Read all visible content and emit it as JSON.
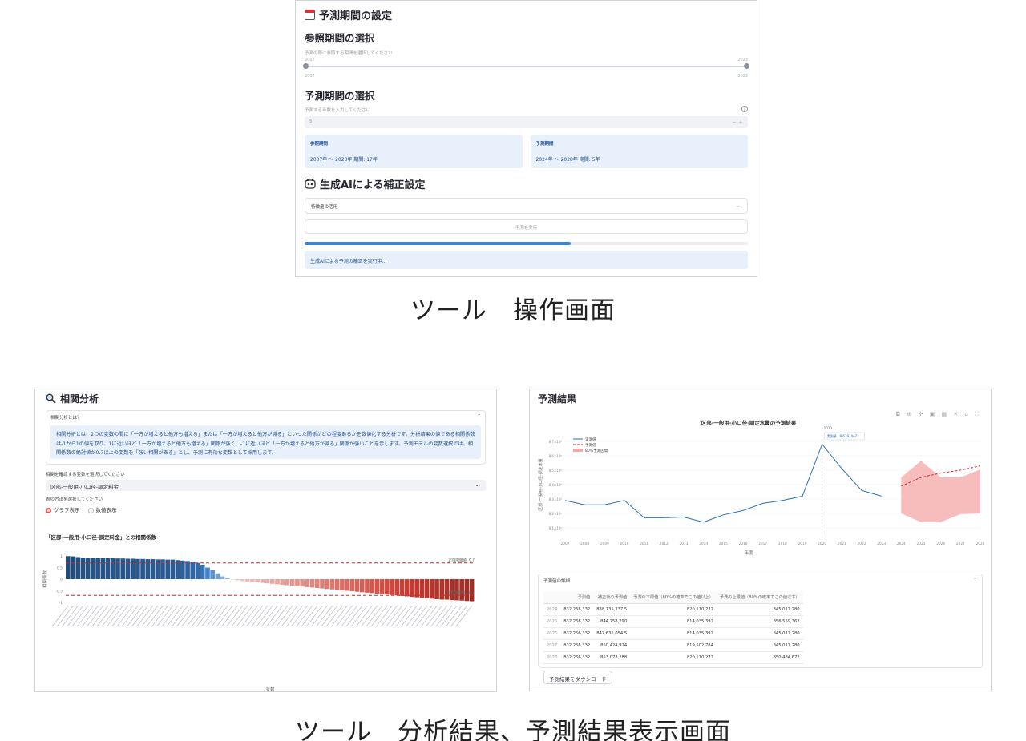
{
  "top_panel": {
    "header_title": "予測期間の設定",
    "reference_title": "参照期間の選択",
    "reference_hint": "予測の際に参照する期間を選択してください",
    "slider_min": "2007",
    "slider_max": "2023",
    "forecast_title": "予測期間の選択",
    "forecast_hint": "予測する年数を入力してください",
    "forecast_value": "5",
    "stepper": "－ ＋",
    "help_icon": "?",
    "ref_card_label": "参照期間",
    "ref_card_value": "2007年 〜 2023年 期間: 17年",
    "fc_card_label": "予測期間",
    "fc_card_value": "2024年 〜 2028年 期間: 5年",
    "ai_title": "生成AIによる補正設定",
    "ai_dropdown": "特徴量の活用",
    "run_button": "予測を実行",
    "progress": 0.6,
    "status": "生成AIによる予測の補正を実行中..."
  },
  "caption_top": "ツール　操作画面",
  "caption_bottom": "ツール　分析結果、予測結果表示画面",
  "analysis_panel": {
    "title": "相関分析",
    "expander_label": "相関分析とは？",
    "expander_text": "相関分析とは、2つの変数の間に「一方が増えると他方も増える」または「一方が増えると他方が減る」といった関係がどの程度あるかを数値化する分析です。分析結果の値である相関係数は-1から1の値を取り、1に近いほど「一方が増えると他方も増える」関係が強く、-1に近いほど「一方が増えると他方が減る」関係が強いことを示します。予測モデルの変数選択では、相関係数の絶対値が0.7以上の変数を「強い相関がある」とし、予測に有効な変数として採用します。",
    "variable_label": "相関を確認する変数を選択してください",
    "variable_value": "区部-一般用-小口径-調定料金",
    "display_label": "表の方法を選択してください",
    "radio_graph": "グラフ表示",
    "radio_number": "数値表示",
    "chart_title": "「区部-一般用-小口径-調定料金」との相関係数",
    "threshold_upper": "正相関閾値: 0.7",
    "threshold_lower": "負相関閾値: -0.7",
    "xlabel": "変数",
    "ylabel": "相関係数"
  },
  "result_panel": {
    "title": "予測結果",
    "toolbar_icons": "◘ ⊕ ✛ ▣ ▦ ✕ ⌂ ⛶",
    "chart_title": "区部-一般用-小口径-調定水量の予測結果",
    "legend_actual": "実測値",
    "legend_forecast": "予測値",
    "legend_band": "80%予測区間",
    "hover_year": "2020",
    "hover_text": "実測値 : 8.67924e7",
    "xlabel": "年度",
    "ylabel": "区部-一般用-小口径-調定水量",
    "table_expander": "予測値の詳細",
    "table_headers": [
      "",
      "予測値",
      "補正後の予測値",
      "予測の下限値（80%の確率でこの値以上）",
      "予測の上限値（80%の確率でこの値以下）"
    ],
    "table_rows": [
      [
        "2024",
        "832,266,332",
        "838,735,237.5",
        "820,110,272",
        "845,017,280"
      ],
      [
        "2025",
        "832,266,332",
        "844,758,290",
        "814,035,392",
        "856,559,362"
      ],
      [
        "2026",
        "832,266,332",
        "847,631,054.5",
        "814,035,392",
        "845,017,280"
      ],
      [
        "2027",
        "832,266,332",
        "850,424,924",
        "819,502,784",
        "845,017,280"
      ],
      [
        "2028",
        "832,266,332",
        "853,073,288",
        "820,110,272",
        "850,484,672"
      ]
    ],
    "download_button": "予測結果をダウンロード"
  },
  "chart_data": [
    {
      "type": "bar",
      "title": "「区部-一般用-小口径-調定料金」との相関係数",
      "xlabel": "変数",
      "ylabel": "相関係数",
      "ylim": [
        -1,
        1
      ],
      "yticks": [
        "1",
        "0.5",
        "0",
        "-0.5",
        "-1"
      ],
      "thresholds": [
        0.7,
        -0.7
      ],
      "values": [
        0.99,
        0.98,
        0.95,
        0.93,
        0.92,
        0.92,
        0.91,
        0.91,
        0.9,
        0.9,
        0.89,
        0.89,
        0.88,
        0.88,
        0.87,
        0.87,
        0.86,
        0.86,
        0.85,
        0.85,
        0.84,
        0.84,
        0.82,
        0.8,
        0.78,
        0.75,
        0.7,
        0.62,
        0.5,
        0.38,
        0.25,
        0.12,
        0.05,
        -0.02,
        -0.05,
        -0.08,
        -0.1,
        -0.12,
        -0.14,
        -0.16,
        -0.18,
        -0.2,
        -0.22,
        -0.24,
        -0.26,
        -0.28,
        -0.3,
        -0.32,
        -0.34,
        -0.36,
        -0.38,
        -0.4,
        -0.42,
        -0.44,
        -0.46,
        -0.48,
        -0.5,
        -0.52,
        -0.54,
        -0.56,
        -0.58,
        -0.6,
        -0.62,
        -0.64,
        -0.66,
        -0.68,
        -0.7,
        -0.72,
        -0.74,
        -0.76,
        -0.78,
        -0.8,
        -0.82,
        -0.84,
        -0.86,
        -0.88,
        -0.88,
        -0.9,
        -0.91,
        -0.92,
        -0.94,
        -0.95
      ]
    },
    {
      "type": "line",
      "title": "区部-一般用-小口径-調定水量の予測結果",
      "xlabel": "年度",
      "ylabel": "区部-一般用-小口径-調定水量",
      "x": [
        2007,
        2008,
        2009,
        2010,
        2011,
        2012,
        2013,
        2014,
        2015,
        2016,
        2017,
        2018,
        2019,
        2020,
        2021,
        2022,
        2023,
        2024,
        2025,
        2026,
        2027,
        2028
      ],
      "xticks": [
        "2007",
        "2008",
        "2009",
        "2010",
        "2011",
        "2012",
        "2013",
        "2014",
        "2015",
        "2016",
        "2017",
        "2018",
        "2019",
        "2020",
        "2021",
        "2022",
        "2023",
        "2024",
        "2025",
        "2026",
        "2027",
        "2028"
      ],
      "yticks": [
        "8.7×10⁸",
        "8.6×10⁸",
        "8.5×10⁸",
        "8.4×10⁸",
        "8.3×10⁸",
        "8.2×10⁸",
        "8.1×10⁸"
      ],
      "ylim": [
        805,
        875
      ],
      "series": [
        {
          "name": "実測値",
          "x": [
            2007,
            2008,
            2009,
            2010,
            2011,
            2012,
            2013,
            2014,
            2015,
            2016,
            2017,
            2018,
            2019,
            2020,
            2021,
            2022,
            2023
          ],
          "values": [
            829,
            826,
            826,
            829,
            817,
            817,
            817.5,
            814,
            819,
            822,
            827,
            829,
            832,
            868,
            851,
            836,
            832
          ]
        },
        {
          "name": "予測値",
          "x": [
            2024,
            2025,
            2026,
            2027,
            2028
          ],
          "values": [
            839,
            845,
            848,
            850,
            853
          ]
        },
        {
          "name": "80%予測区間",
          "x": [
            2024,
            2025,
            2026,
            2027,
            2028
          ],
          "lower": [
            820,
            814,
            814,
            819.5,
            820
          ],
          "upper": [
            845,
            856.5,
            845,
            845,
            850.5
          ]
        }
      ]
    }
  ]
}
